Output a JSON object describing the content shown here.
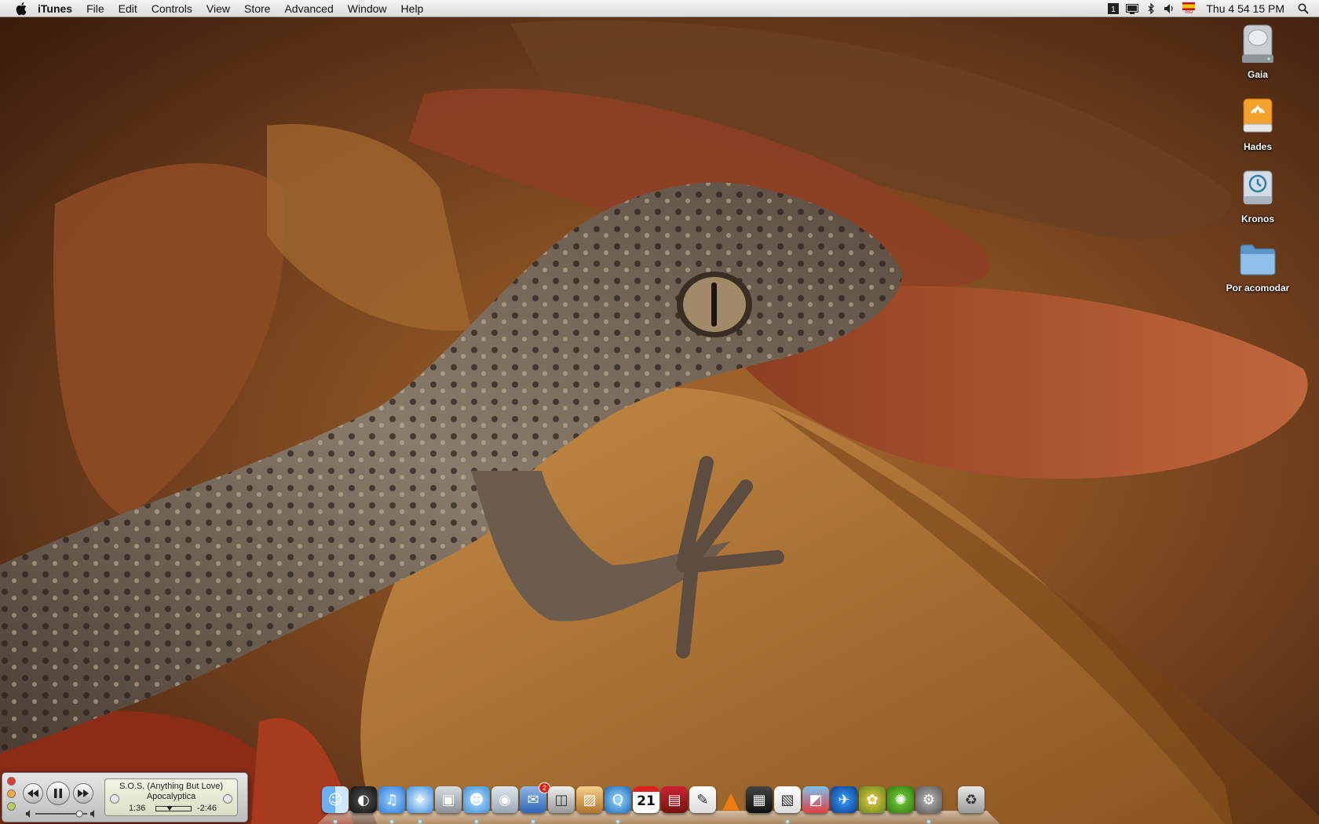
{
  "menubar": {
    "apple_icon": "apple-icon",
    "app_name": "iTunes",
    "menus": [
      "File",
      "Edit",
      "Controls",
      "View",
      "Store",
      "Advanced",
      "Window",
      "Help"
    ],
    "status_icons": [
      "spaces-icon",
      "display-icon",
      "bluetooth-icon",
      "volume-icon",
      "input-source-flag-icon"
    ],
    "input_source_label": "ISO",
    "clock": "Thu 4 54 15 PM",
    "spotlight_icon": "spotlight-search-icon"
  },
  "desktop": {
    "icons": [
      {
        "label": "Gaia",
        "icon": "hard-drive-icon"
      },
      {
        "label": "Hades",
        "icon": "firewire-drive-icon"
      },
      {
        "label": "Kronos",
        "icon": "time-machine-drive-icon"
      },
      {
        "label": "Por acomodar",
        "icon": "folder-icon"
      }
    ]
  },
  "miniplayer": {
    "song": "S.O.S. (Anything But Love)",
    "artist": "Apocalyptica",
    "elapsed": "1:36",
    "remaining": "-2:46",
    "progress": 0.37,
    "volume": 0.85,
    "state": "playing"
  },
  "dock": {
    "apps": [
      "finder-icon",
      "dashboard-icon",
      "itunes-icon",
      "safari-icon",
      "image-capture-icon",
      "ichat-icon",
      "facetime-icon",
      "mail-icon",
      "screenshot-icon",
      "iphoto-icon",
      "quicktime-icon",
      "ical-icon",
      "photo-booth-icon",
      "textedit-icon",
      "vlc-icon",
      "clapper-icon",
      "preview-icon",
      "desktop-picture-icon",
      "bird-app-icon",
      "pineapple-app-icon",
      "gear-app-icon",
      "system-preferences-icon",
      "trash-icon"
    ],
    "ical_date": "21",
    "mail_badge": "2"
  },
  "colors": {
    "menubar": "#e8e8e8",
    "folder": "#6fa8dc",
    "dock_indicator": "#aee6ff"
  }
}
